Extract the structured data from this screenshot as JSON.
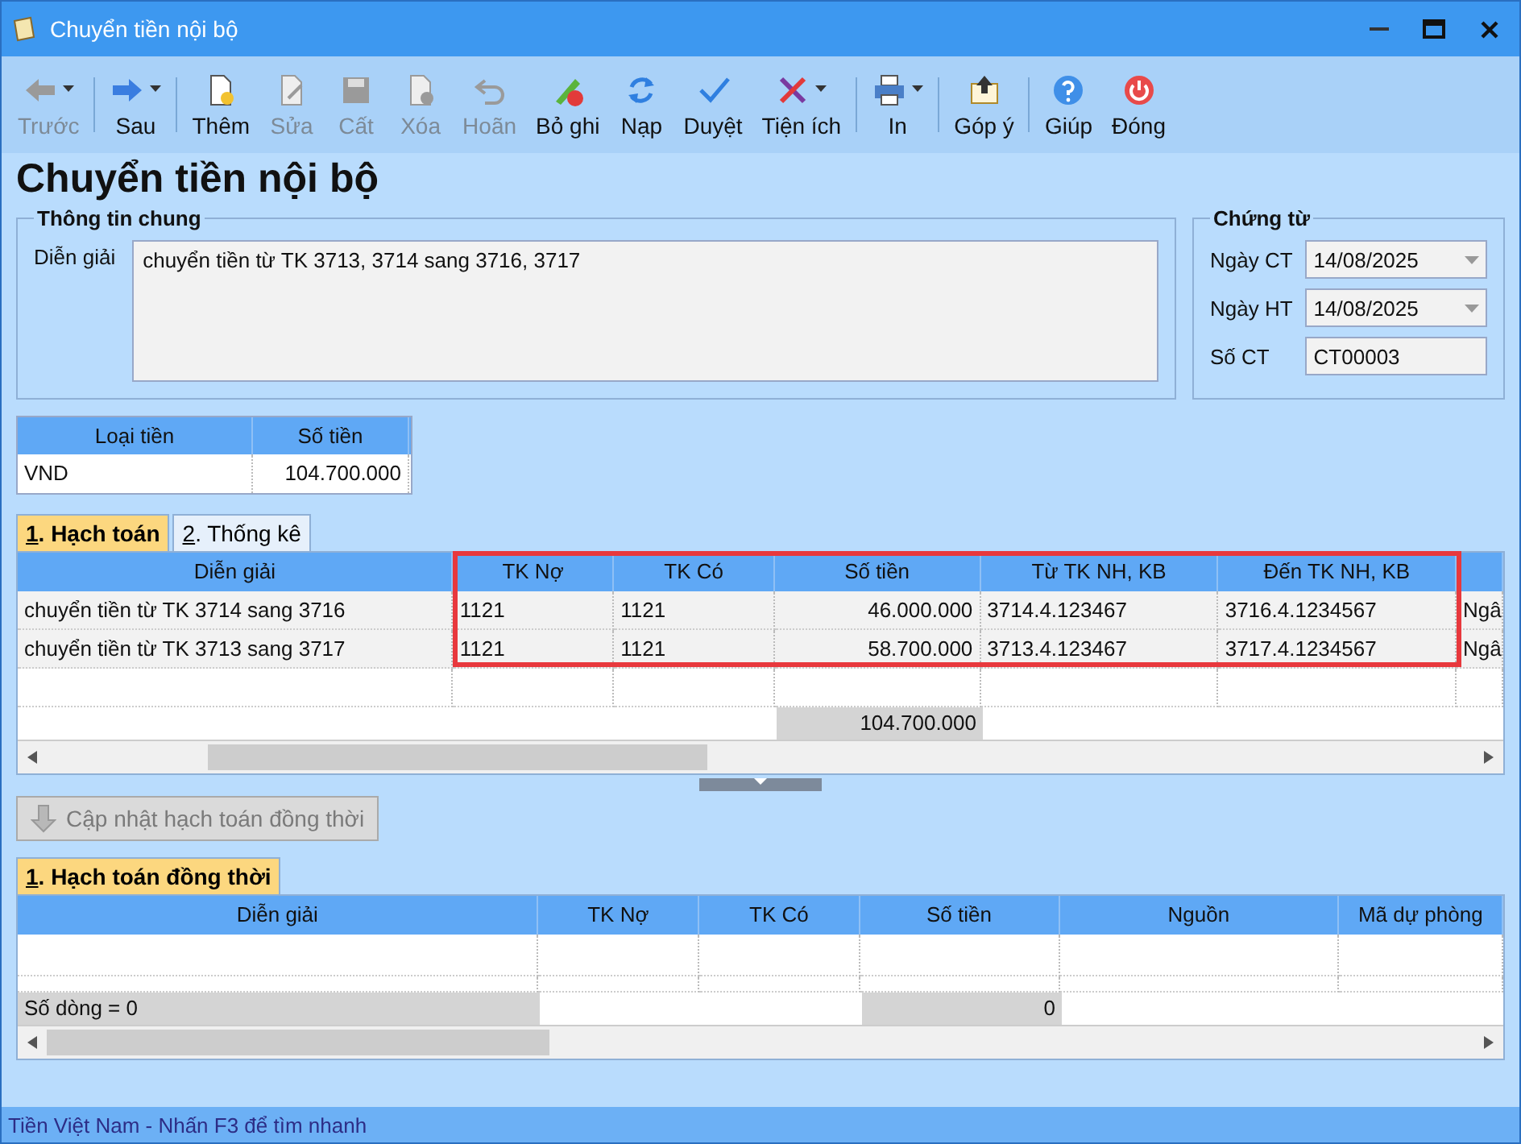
{
  "window": {
    "title": "Chuyển tiền nội bộ"
  },
  "toolbar_groups": [
    [
      {
        "label": "Trước",
        "disabled": true,
        "dropdown": true
      }
    ],
    [
      {
        "label": "Sau",
        "disabled": false,
        "dropdown": true
      }
    ],
    [
      {
        "label": "Thêm",
        "disabled": false,
        "dropdown": false
      },
      {
        "label": "Sửa",
        "disabled": true,
        "dropdown": false
      },
      {
        "label": "Cất",
        "disabled": true,
        "dropdown": false
      },
      {
        "label": "Xóa",
        "disabled": true,
        "dropdown": false
      },
      {
        "label": "Hoãn",
        "disabled": true,
        "dropdown": false
      },
      {
        "label": "Bỏ ghi",
        "disabled": false,
        "dropdown": false
      },
      {
        "label": "Nạp",
        "disabled": false,
        "dropdown": false
      },
      {
        "label": "Duyệt",
        "disabled": false,
        "dropdown": false
      },
      {
        "label": "Tiện ích",
        "disabled": false,
        "dropdown": true
      }
    ],
    [
      {
        "label": "In",
        "disabled": false,
        "dropdown": true
      }
    ],
    [
      {
        "label": "Góp ý",
        "disabled": false,
        "dropdown": false
      }
    ],
    [
      {
        "label": "Giúp",
        "disabled": false,
        "dropdown": false
      },
      {
        "label": "Đóng",
        "disabled": false,
        "dropdown": false
      }
    ]
  ],
  "page_title": "Chuyển tiền nội bộ",
  "general_info": {
    "legend": "Thông tin chung",
    "label": "Diễn giải",
    "value": "chuyển tiền từ TK 3713, 3714 sang 3716, 3717"
  },
  "voucher": {
    "legend": "Chứng từ",
    "fields": [
      {
        "label": "Ngày CT",
        "value": "14/08/2025",
        "kind": "date"
      },
      {
        "label": "Ngày HT",
        "value": "14/08/2025",
        "kind": "date"
      },
      {
        "label": "Số CT",
        "value": "CT00003",
        "kind": "text"
      }
    ]
  },
  "currency_table": {
    "columns": [
      "Loại tiền",
      "Số tiền"
    ],
    "rows": [
      [
        "VND",
        "104.700.000"
      ]
    ]
  },
  "tabs": [
    {
      "label": "1. Hạch toán",
      "selected": true
    },
    {
      "label": "2. Thống kê",
      "selected": false
    }
  ],
  "entries_table": {
    "columns": [
      "Diễn giải",
      "TK Nợ",
      "TK Có",
      "Số tiền",
      "Từ TK NH, KB",
      "Đến TK NH, KB",
      ""
    ],
    "rows": [
      [
        "chuyển tiền từ TK  3714 sang 3716",
        "1121",
        "1121",
        "46.000.000",
        "3714.4.123467",
        "3716.4.1234567",
        "Ngâ"
      ],
      [
        "chuyển tiền từ TK 3713 sang 3717",
        "1121",
        "1121",
        "58.700.000",
        "3713.4.123467",
        "3717.4.1234567",
        "Ngâ"
      ]
    ],
    "total": "104.700.000"
  },
  "update_button": {
    "label": "Cập nhật hạch toán đồng thời",
    "disabled": true
  },
  "tabs_2": [
    {
      "label": "1. Hạch toán đồng thời",
      "selected": true
    }
  ],
  "concurrent_table": {
    "columns": [
      "Diễn giải",
      "TK Nợ",
      "TK Có",
      "Số tiền",
      "Nguồn",
      "Mã dự phòng"
    ],
    "row_count": "Số dòng = 0",
    "total": "0"
  },
  "status_bar": "Tiền Việt Nam - Nhấn F3 để tìm nhanh"
}
